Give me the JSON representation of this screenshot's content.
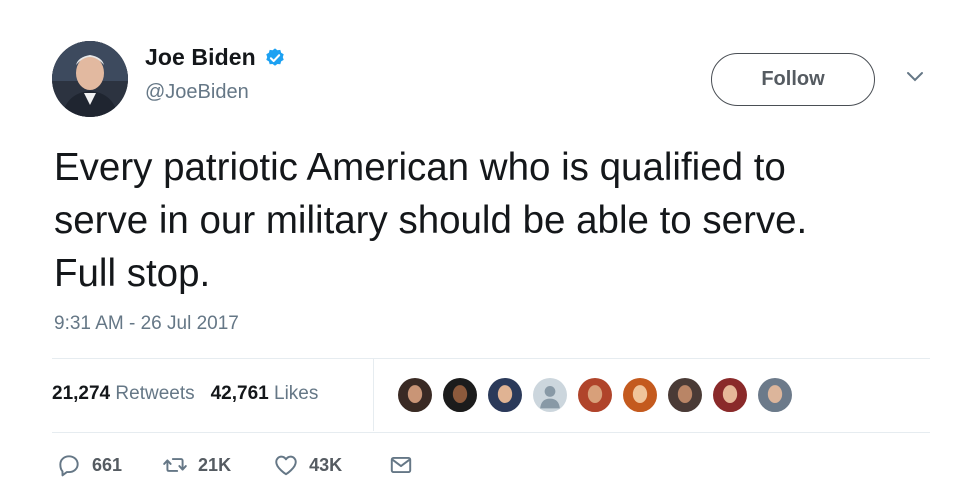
{
  "user": {
    "display_name": "Joe Biden",
    "handle": "@JoeBiden",
    "verified": true,
    "avatar_icon": "person-photo"
  },
  "follow_button": {
    "label": "Follow"
  },
  "menu_icon": "chevron-down-icon",
  "tweet": {
    "text_line1": "Every patriotic American who is qualified to",
    "text_line2": "serve in our military should be able to serve.",
    "text_line3": "Full stop.",
    "timestamp": "9:31 AM - 26 Jul 2017"
  },
  "stats": {
    "retweets_count": "21,274",
    "retweets_label": "Retweets",
    "likes_count": "42,761",
    "likes_label": "Likes"
  },
  "likers": [
    {
      "icon": "user-avatar",
      "bg": "#3a2a24"
    },
    {
      "icon": "user-avatar",
      "bg": "#1c1c1c"
    },
    {
      "icon": "user-avatar",
      "bg": "#2b3a5a"
    },
    {
      "icon": "default-avatar",
      "bg": "#ccd6dd"
    },
    {
      "icon": "user-avatar",
      "bg": "#b0442a"
    },
    {
      "icon": "user-avatar",
      "bg": "#c45a1e"
    },
    {
      "icon": "user-avatar",
      "bg": "#4a3b36"
    },
    {
      "icon": "user-avatar",
      "bg": "#8a2a2a"
    },
    {
      "icon": "user-avatar",
      "bg": "#6c7a8a"
    }
  ],
  "actions": {
    "reply_count": "661",
    "retweet_count": "21K",
    "like_count": "43K"
  },
  "colors": {
    "verified_blue": "#1da1f2",
    "secondary_text": "#657786",
    "divider": "#e6ecf0"
  }
}
